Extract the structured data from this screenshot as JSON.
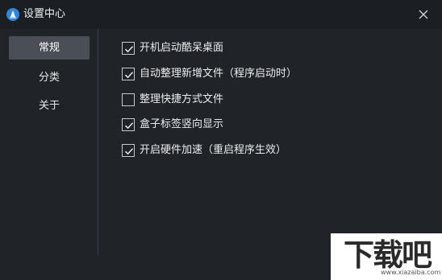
{
  "window": {
    "title": "设置中心",
    "logo_icon": "boat-icon",
    "close_icon": "close-icon"
  },
  "sidebar": {
    "items": [
      {
        "label": "常规",
        "active": true
      },
      {
        "label": "分类",
        "active": false
      },
      {
        "label": "关于",
        "active": false
      }
    ]
  },
  "options": [
    {
      "label": "开机启动酷呆桌面",
      "checked": true
    },
    {
      "label": "自动整理新增文件（程序启动时）",
      "checked": true
    },
    {
      "label": "整理快捷方式文件",
      "checked": false
    },
    {
      "label": "盒子标签竖向显示",
      "checked": true
    },
    {
      "label": "开启硬件加速（重启程序生效）",
      "checked": true
    }
  ],
  "watermark": {
    "logo_text": "下载吧",
    "url": "www.xiazaiba.com"
  },
  "colors": {
    "background": "#202428",
    "titlebar": "#1b1e22",
    "active_nav": "#4a4f57",
    "logo_blue": "#2f86de"
  }
}
